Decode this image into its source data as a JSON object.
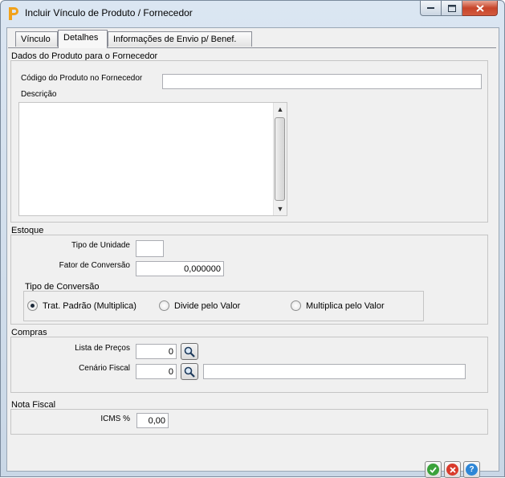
{
  "window": {
    "title": "Incluir Vínculo de Produto / Fornecedor"
  },
  "tabs": [
    {
      "label": "Vínculo"
    },
    {
      "label": "Detalhes"
    },
    {
      "label": "Informações de Envio p/ Benef."
    }
  ],
  "produto": {
    "section_title": "Dados do Produto para o Fornecedor",
    "codigo_label": "Código do Produto no Fornecedor",
    "codigo_value": "",
    "descricao_label": "Descrição",
    "descricao_value": ""
  },
  "estoque": {
    "section_title": "Estoque",
    "tipo_unidade_label": "Tipo de Unidade",
    "tipo_unidade_value": "",
    "fator_label": "Fator de Conversão",
    "fator_value": "0,000000",
    "tipo_conversao_title": "Tipo de Conversão",
    "options": [
      {
        "label": "Trat. Padrão (Multiplica)",
        "selected": true
      },
      {
        "label": "Divide pelo Valor",
        "selected": false
      },
      {
        "label": "Multiplica pelo Valor",
        "selected": false
      }
    ]
  },
  "compras": {
    "section_title": "Compras",
    "lista_label": "Lista de Preços",
    "lista_value": "0",
    "cenario_label": "Cenário Fiscal",
    "cenario_value": "0",
    "cenario_desc": ""
  },
  "nota": {
    "section_title": "Nota Fiscal",
    "icms_label": "ICMS %",
    "icms_value": "0,00"
  },
  "icons": {
    "app": "p-logo-icon",
    "lookup": "search-icon",
    "confirm": "check-icon",
    "cancel": "close-icon",
    "help": "help-icon"
  },
  "colors": {
    "confirm": "#3aa23a",
    "cancel": "#d93a2b",
    "help": "#2d86d6",
    "app_icon": "#f1a21a"
  }
}
